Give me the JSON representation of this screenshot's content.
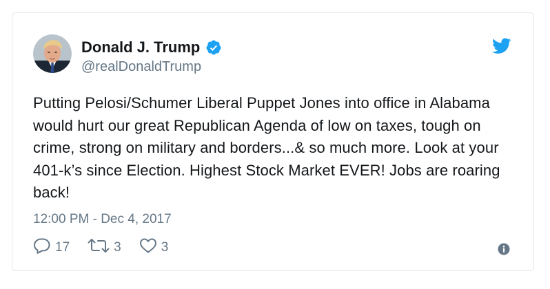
{
  "tweet": {
    "author_name": "Donald J. Trump",
    "author_handle": "@realDonaldTrump",
    "text": "Putting Pelosi/Schumer Liberal Puppet Jones into office in Alabama would hurt our great Republican Agenda of low on taxes, tough on crime, strong on military and borders...& so much more. Look at your 401-k’s since Election. Highest Stock Market EVER! Jobs are roaring back!",
    "timestamp": "12:00 PM - Dec 4, 2017",
    "reply_count": "17",
    "retweet_count": "3",
    "like_count": "3"
  },
  "icons": {
    "verified": "verified-badge-icon",
    "brand": "twitter-bird-icon",
    "reply": "reply-icon",
    "retweet": "retweet-icon",
    "like": "heart-icon",
    "info": "info-icon"
  },
  "colors": {
    "brand_blue": "#1da1f2",
    "secondary_text": "#657786",
    "primary_text": "#14171a",
    "border": "#e1e8ed"
  }
}
